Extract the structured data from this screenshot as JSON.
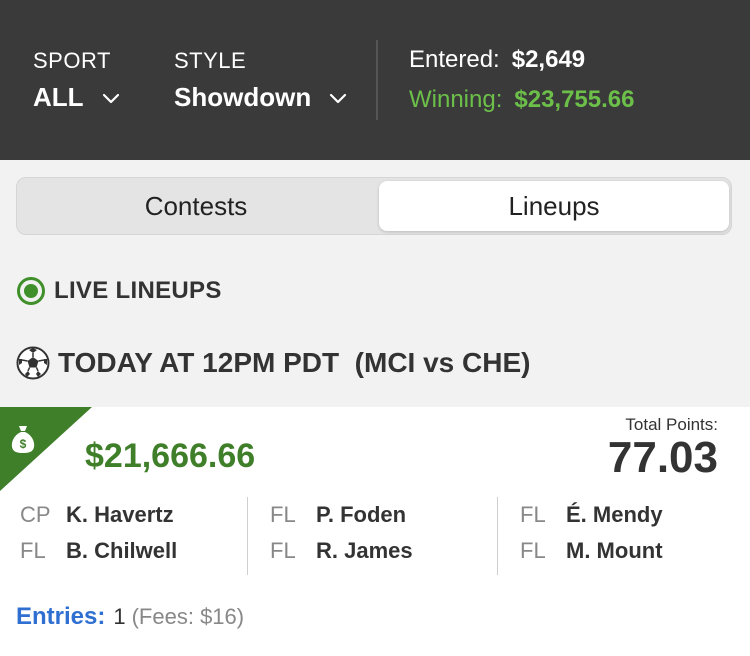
{
  "header": {
    "sport_label": "SPORT",
    "sport_value": "ALL",
    "style_label": "STYLE",
    "style_value": "Showdown",
    "entered_label": "Entered:",
    "entered_value": "$2,649",
    "winning_label": "Winning:",
    "winning_value": "$23,755.66"
  },
  "tabs": {
    "contests": "Contests",
    "lineups": "Lineups",
    "active": "Lineups"
  },
  "live": {
    "label": "LIVE LINEUPS"
  },
  "game": {
    "label": "TODAY AT 12PM PDT  (MCI vs CHE)"
  },
  "lineup": {
    "winnings": "$21,666.66",
    "total_points_label": "Total Points:",
    "total_points": "77.03",
    "players": [
      {
        "pos": "CP",
        "name": "K. Havertz"
      },
      {
        "pos": "FL",
        "name": "B. Chilwell"
      },
      {
        "pos": "FL",
        "name": "P. Foden"
      },
      {
        "pos": "FL",
        "name": "R. James"
      },
      {
        "pos": "FL",
        "name": "É. Mendy"
      },
      {
        "pos": "FL",
        "name": "M. Mount"
      }
    ],
    "entries_label": "Entries:",
    "entries_count": "1",
    "fees": "(Fees: $16)"
  },
  "colors": {
    "header_bg": "#3a3a3a",
    "accent_green": "#6cc04a",
    "win_green": "#3f7f2a",
    "link_blue": "#2f6fd1"
  },
  "icons": [
    "chevron-down-icon",
    "live-radio-icon",
    "soccer-ball-icon",
    "money-bag-icon"
  ]
}
